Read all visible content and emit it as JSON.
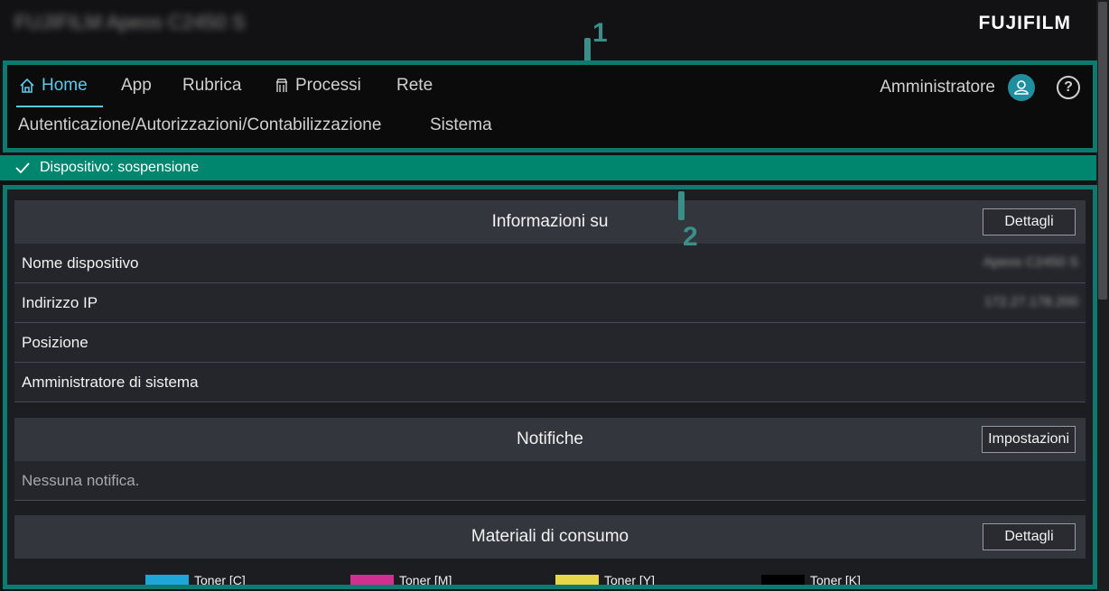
{
  "header": {
    "device_title": "FUJIFILM Apeos C2450 S",
    "brand": "FUJIFILM"
  },
  "callouts": [
    "1",
    "2"
  ],
  "nav": {
    "primary": [
      {
        "label": "Home",
        "icon": "home-icon",
        "active": true
      },
      {
        "label": "App"
      },
      {
        "label": "Rubrica"
      },
      {
        "label": "Processi",
        "icon": "jobs-icon"
      },
      {
        "label": "Rete"
      }
    ],
    "secondary": [
      {
        "label": "Autenticazione/Autorizzazioni/Contabilizzazione"
      },
      {
        "label": "Sistema"
      }
    ],
    "user_label": "Amministratore",
    "user_icon": "user-icon",
    "help_icon": "help-icon"
  },
  "status": {
    "text": "Dispositivo: sospensione",
    "icon": "check-icon",
    "color": "#00856f"
  },
  "info": {
    "title": "Informazioni su",
    "button": "Dettagli",
    "rows": [
      {
        "label": "Nome dispositivo",
        "value": "Apeos C2450 S"
      },
      {
        "label": "Indirizzo IP",
        "value": "172.27.178.200"
      },
      {
        "label": "Posizione",
        "value": ""
      },
      {
        "label": "Amministratore di sistema",
        "value": ""
      }
    ]
  },
  "notifications": {
    "title": "Notifiche",
    "button": "Impostazioni",
    "empty": "Nessuna notifica."
  },
  "supplies": {
    "title": "Materiali di consumo",
    "button": "Dettagli",
    "items": [
      {
        "label": "Toner [C]",
        "color": "#1ea6d8"
      },
      {
        "label": "Toner [M]",
        "color": "#d0308f"
      },
      {
        "label": "Toner [Y]",
        "color": "#e8d64a"
      },
      {
        "label": "Toner [K]",
        "color": "#000000"
      }
    ]
  },
  "colors": {
    "accent": "#5fc8e8",
    "frame": "#0d7a70"
  }
}
